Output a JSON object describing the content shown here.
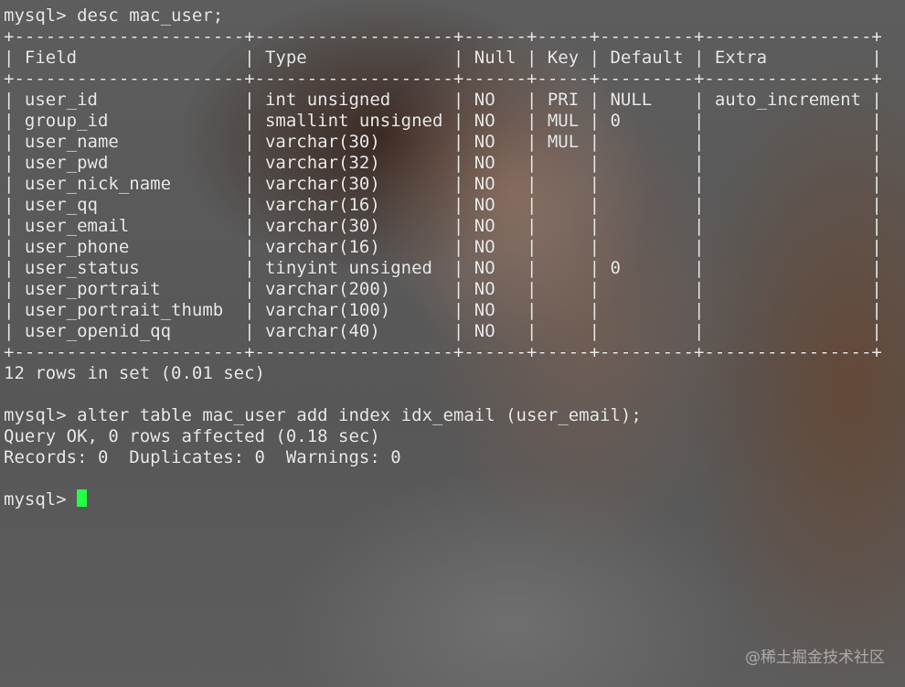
{
  "terminal": {
    "prompt": "mysql> ",
    "command_1": "desc mac_user;",
    "table": {
      "border": "+----------------------+-------------------+------+-----+---------+----------------+",
      "header": "| Field                | Type              | Null | Key | Default | Extra          |",
      "rows": [
        "| user_id              | int unsigned      | NO   | PRI | NULL    | auto_increment |",
        "| group_id             | smallint unsigned | NO   | MUL | 0       |                |",
        "| user_name            | varchar(30)       | NO   | MUL |         |                |",
        "| user_pwd             | varchar(32)       | NO   |     |         |                |",
        "| user_nick_name       | varchar(30)       | NO   |     |         |                |",
        "| user_qq              | varchar(16)       | NO   |     |         |                |",
        "| user_email           | varchar(30)       | NO   |     |         |                |",
        "| user_phone           | varchar(16)       | NO   |     |         |                |",
        "| user_status          | tinyint unsigned  | NO   |     | 0       |                |",
        "| user_portrait        | varchar(200)      | NO   |     |         |                |",
        "| user_portrait_thumb  | varchar(100)      | NO   |     |         |                |",
        "| user_openid_qq       | varchar(40)       | NO   |     |         |                |"
      ]
    },
    "rows_in_set": "12 rows in set (0.01 sec)",
    "command_2": "alter table mac_user add index idx_email (user_email);",
    "query_ok": "Query OK, 0 rows affected (0.18 sec)",
    "records": "Records: 0  Duplicates: 0  Warnings: 0",
    "cursor_color": "#22ff44"
  },
  "watermark": "@稀土掘金技术社区"
}
